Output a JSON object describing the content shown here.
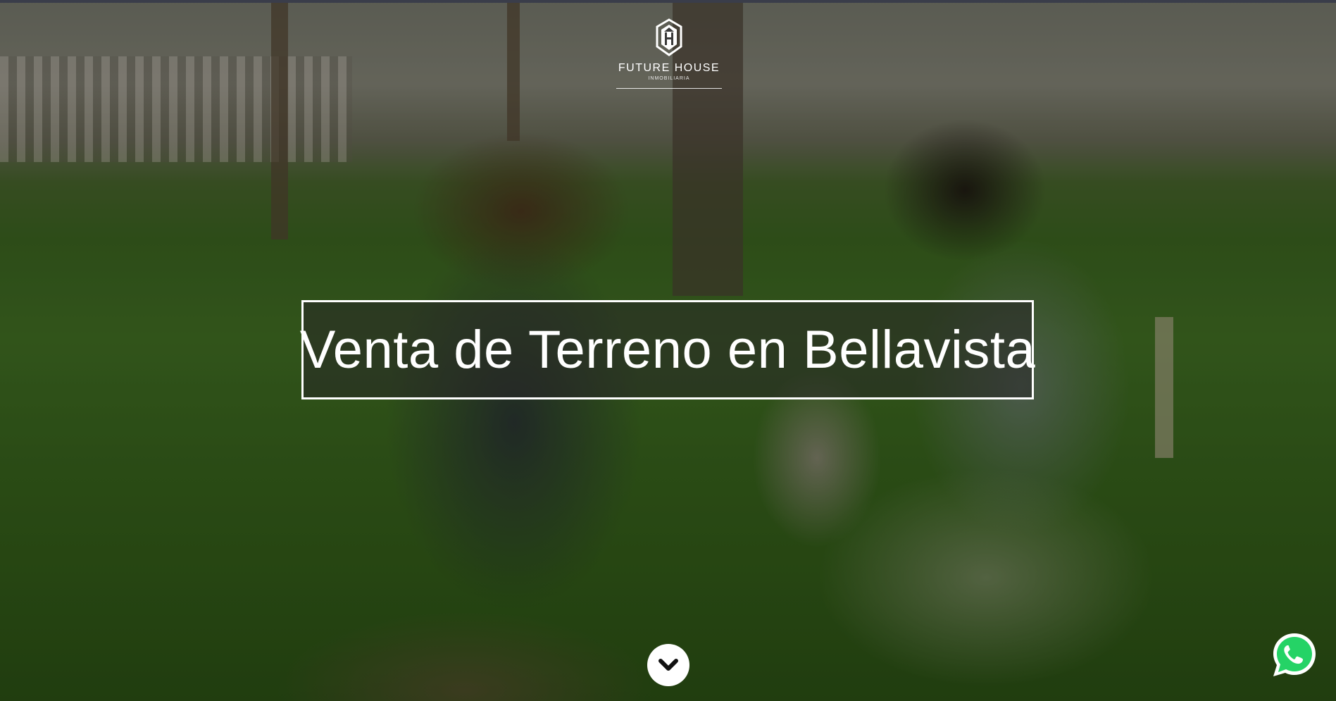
{
  "brand": {
    "name": "FUTURE HOUSE",
    "tagline": "INMOBILIARIA",
    "logo_icon": "house-h-icon"
  },
  "hero": {
    "title": "Venta de Terreno en Bellavista",
    "scroll_icon": "chevron-down-icon"
  },
  "floating": {
    "whatsapp_icon": "whatsapp-icon",
    "whatsapp_color": "#25D366"
  },
  "colors": {
    "overlay": "#000000",
    "title_border": "#ffffff",
    "text": "#ffffff"
  }
}
